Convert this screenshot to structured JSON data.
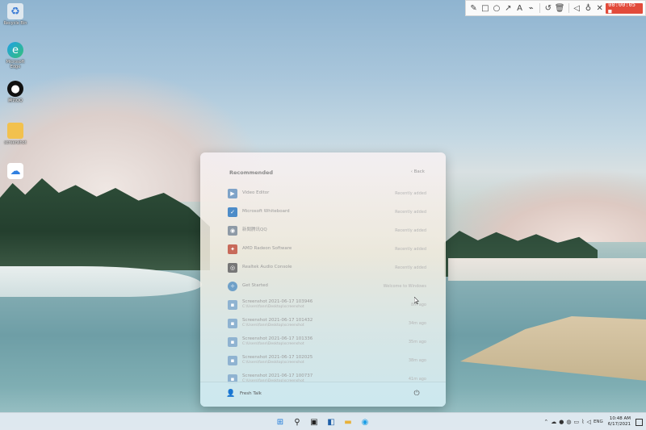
{
  "desktop": {
    "icons": [
      {
        "label": "Recycle Bin",
        "icon": "recycle-bin-icon"
      },
      {
        "label": "Microsoft Edge",
        "icon": "edge-icon"
      },
      {
        "label": "腾讯QQ",
        "icon": "qq-icon"
      },
      {
        "label": "screenshot",
        "icon": "folder-icon"
      },
      {
        "label": "",
        "icon": "baidu-netdisk-icon"
      }
    ]
  },
  "recorder": {
    "tools": [
      "pen-icon",
      "rectangle-icon",
      "ellipse-icon",
      "arrow-icon",
      "text-icon",
      "marker-icon",
      "undo-icon",
      "trash-icon",
      "speaker-icon",
      "microphone-icon",
      "close-icon"
    ],
    "timer": "00:00:05 ■"
  },
  "start_menu": {
    "heading": "Recommended",
    "back_label": "Back",
    "items": [
      {
        "name": "Video Editor",
        "path": "",
        "meta": "Recently added",
        "icon": "video-editor-icon",
        "color": "#7fa3c8"
      },
      {
        "name": "Microsoft Whiteboard",
        "path": "",
        "meta": "Recently added",
        "icon": "whiteboard-icon",
        "color": "#4d8cc8"
      },
      {
        "name": "新聞腾讯QQ",
        "path": "",
        "meta": "Recently added",
        "icon": "qq-icon",
        "color": "#8e9aa6"
      },
      {
        "name": "AMD Radeon Software",
        "path": "",
        "meta": "Recently added",
        "icon": "amd-icon",
        "color": "#c86a5a"
      },
      {
        "name": "Realtek Audio Console",
        "path": "",
        "meta": "Recently added",
        "icon": "audio-icon",
        "color": "#777777"
      },
      {
        "name": "Get Started",
        "path": "",
        "meta": "Welcome to Windows",
        "icon": "get-started-icon",
        "color": "#6fa0c8"
      },
      {
        "name": "Screenshot 2021-06-17 103946",
        "path": "C:\\Users\\fann\\Desktop\\screenshot",
        "meta": "8m ago",
        "icon": "image-file-icon",
        "color": "#8fb3d1"
      },
      {
        "name": "Screenshot 2021-06-17 101432",
        "path": "C:\\Users\\fann\\Desktop\\screenshot",
        "meta": "34m ago",
        "icon": "image-file-icon",
        "color": "#8fb3d1"
      },
      {
        "name": "Screenshot 2021-06-17 101336",
        "path": "C:\\Users\\fann\\Desktop\\screenshot",
        "meta": "35m ago",
        "icon": "image-file-icon",
        "color": "#8fb3d1"
      },
      {
        "name": "Screenshot 2021-06-17 102025",
        "path": "C:\\Users\\fann\\Desktop\\screenshot",
        "meta": "38m ago",
        "icon": "image-file-icon",
        "color": "#8fb3d1"
      },
      {
        "name": "Screenshot 2021-06-17 100737",
        "path": "C:\\Users\\fann\\Desktop\\screenshot",
        "meta": "41m ago",
        "icon": "image-file-icon",
        "color": "#8fb3d1"
      }
    ],
    "user_name": "Fresh Talk"
  },
  "taskbar": {
    "apps": [
      "start-icon",
      "search-icon",
      "file-explorer-icon",
      "widgets-icon",
      "folder-icon",
      "edge-icon"
    ],
    "tray_language": "ENG",
    "time": "10:48 AM",
    "date": "6/17/2021"
  }
}
